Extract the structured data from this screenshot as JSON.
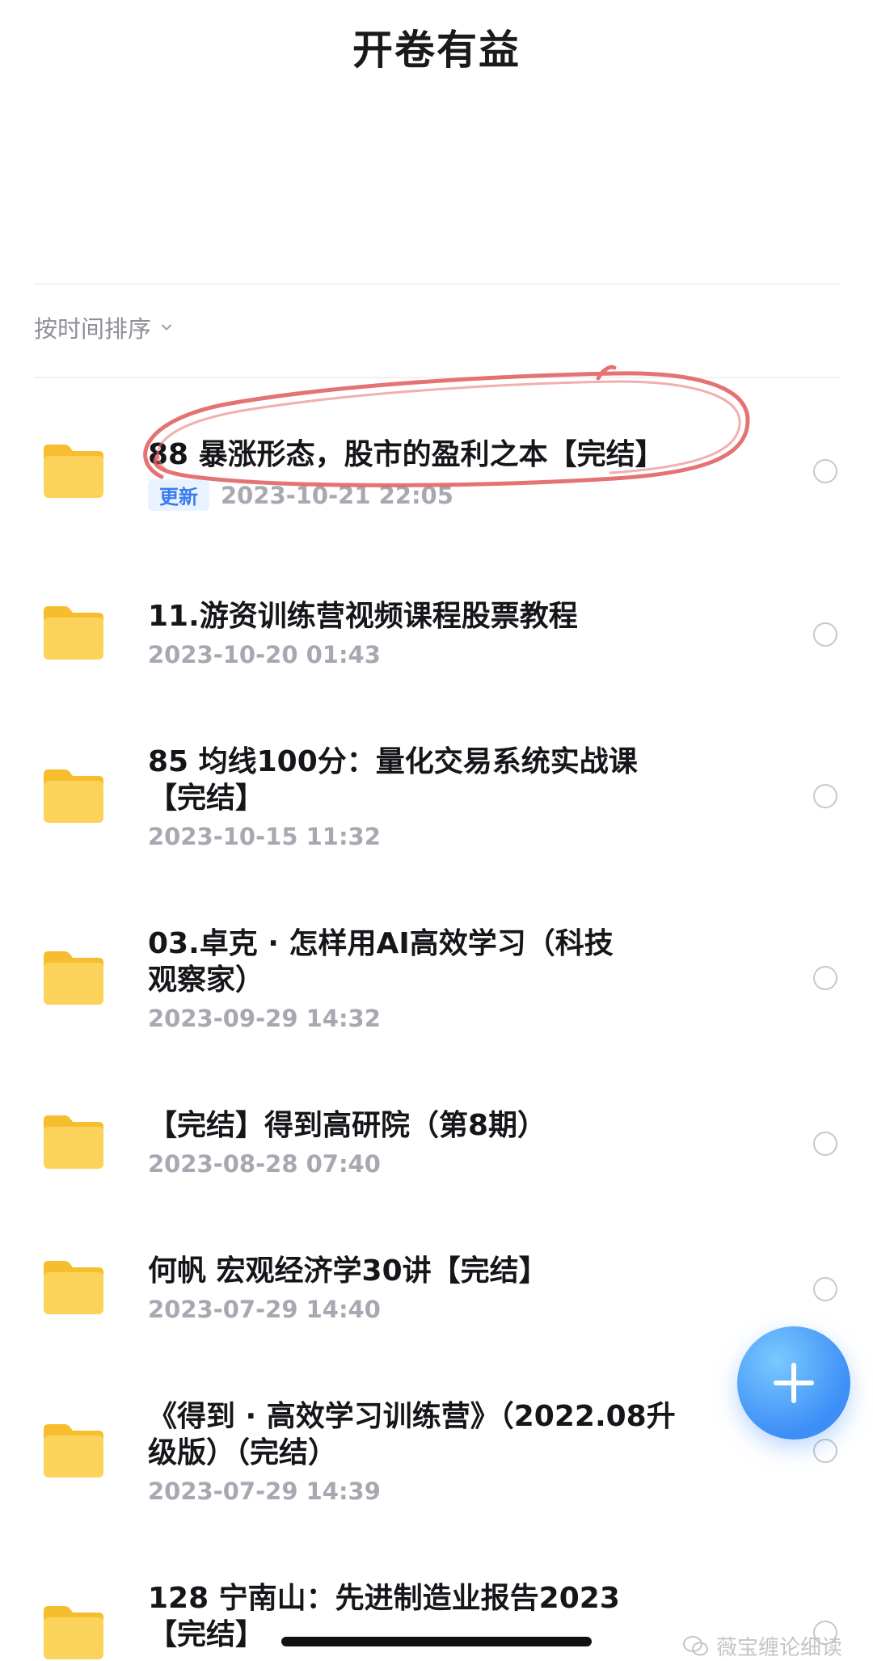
{
  "header": {
    "title": "开卷有益"
  },
  "sort": {
    "label": "按时间排序"
  },
  "items": [
    {
      "title": "88 暴涨形态，股市的盈利之本【完结】",
      "badge": "更新",
      "date": "2023-10-21 22:05"
    },
    {
      "title": "11.游资训练营视频课程股票教程",
      "date": "2023-10-20 01:43"
    },
    {
      "title": "85 均线100分：量化交易系统实战课\n【完结】",
      "date": "2023-10-15 11:32"
    },
    {
      "title": "03.卓克 · 怎样用AI高效学习（科技\n观察家）",
      "date": "2023-09-29 14:32"
    },
    {
      "title": "【完结】得到高研院（第8期）",
      "date": "2023-08-28 07:40"
    },
    {
      "title": "何帆 宏观经济学30讲【完结】",
      "date": "2023-07-29 14:40"
    },
    {
      "title": "《得到 · 高效学习训练营》（2022.08升\n级版）（完结）",
      "date": "2023-07-29 14:39"
    },
    {
      "title": "128 宁南山：先进制造业报告2023\n【完结】",
      "date": ""
    }
  ],
  "watermark": {
    "text": "薇宝缠论细读"
  },
  "colors": {
    "accent": "#3d8ef7",
    "folder": "#fcd35a",
    "annotation": "#e05a5a"
  },
  "icons": {
    "fab": "plus-icon",
    "folder": "folder-icon",
    "sort": "chevron-down-icon"
  }
}
